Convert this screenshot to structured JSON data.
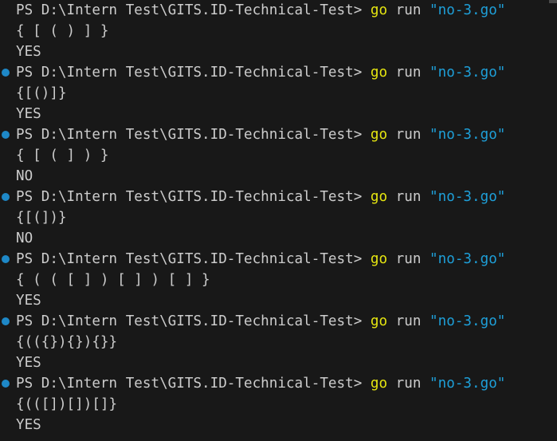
{
  "theme": {
    "background": "#181818",
    "text_color": "#cccccc",
    "command_color": "#e5e510",
    "string_color": "#1e9fd8",
    "decoration_color": "#1e88c7"
  },
  "terminal": {
    "entries": [
      {
        "decorated": false,
        "prompt": "PS D:\\Intern Test\\GITS.ID-Technical-Test>",
        "cmd": "go",
        "arg1": "run",
        "arg2": "\"no-3.go\"",
        "input": "{ [ ( ) ] }",
        "result": "YES"
      },
      {
        "decorated": true,
        "prompt": "PS D:\\Intern Test\\GITS.ID-Technical-Test>",
        "cmd": "go",
        "arg1": "run",
        "arg2": "\"no-3.go\"",
        "input": "{[()]}",
        "result": "YES"
      },
      {
        "decorated": true,
        "prompt": "PS D:\\Intern Test\\GITS.ID-Technical-Test>",
        "cmd": "go",
        "arg1": "run",
        "arg2": "\"no-3.go\"",
        "input": "{ [ ( ] ) }",
        "result": "NO"
      },
      {
        "decorated": true,
        "prompt": "PS D:\\Intern Test\\GITS.ID-Technical-Test>",
        "cmd": "go",
        "arg1": "run",
        "arg2": "\"no-3.go\"",
        "input": "{[(])}",
        "result": "NO"
      },
      {
        "decorated": true,
        "prompt": "PS D:\\Intern Test\\GITS.ID-Technical-Test>",
        "cmd": "go",
        "arg1": "run",
        "arg2": "\"no-3.go\"",
        "input": "{ ( ( [ ] ) [ ] ) [ ] }",
        "result": "YES"
      },
      {
        "decorated": true,
        "prompt": "PS D:\\Intern Test\\GITS.ID-Technical-Test>",
        "cmd": "go",
        "arg1": "run",
        "arg2": "\"no-3.go\"",
        "input": "{(({}){}){}}",
        "result": "YES"
      },
      {
        "decorated": true,
        "prompt": "PS D:\\Intern Test\\GITS.ID-Technical-Test>",
        "cmd": "go",
        "arg1": "run",
        "arg2": "\"no-3.go\"",
        "input": "{(([])[])[]}",
        "result": "YES"
      }
    ]
  }
}
